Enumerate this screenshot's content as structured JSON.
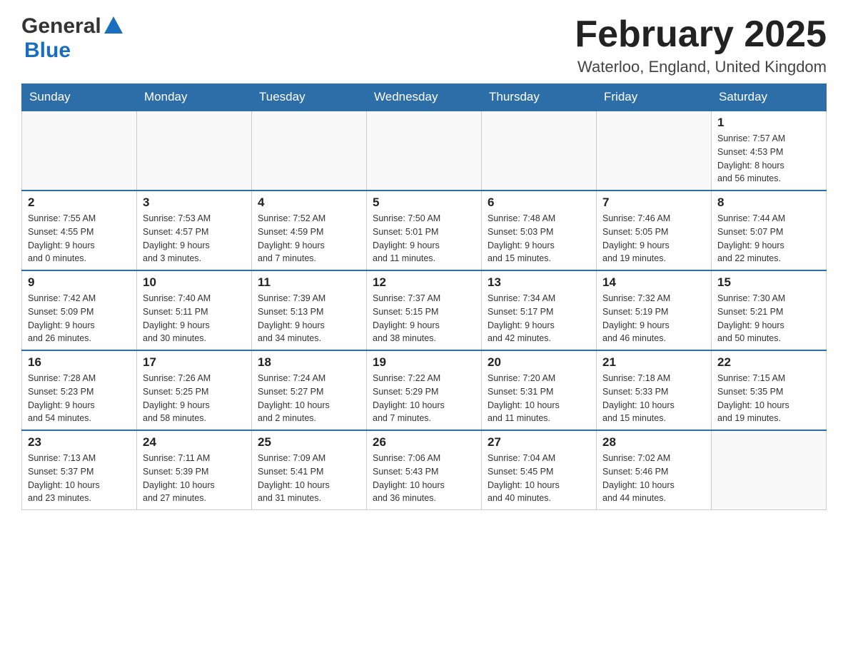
{
  "header": {
    "logo_general": "General",
    "logo_blue": "Blue",
    "month_title": "February 2025",
    "location": "Waterloo, England, United Kingdom"
  },
  "weekdays": [
    "Sunday",
    "Monday",
    "Tuesday",
    "Wednesday",
    "Thursday",
    "Friday",
    "Saturday"
  ],
  "weeks": [
    [
      {
        "day": "",
        "info": ""
      },
      {
        "day": "",
        "info": ""
      },
      {
        "day": "",
        "info": ""
      },
      {
        "day": "",
        "info": ""
      },
      {
        "day": "",
        "info": ""
      },
      {
        "day": "",
        "info": ""
      },
      {
        "day": "1",
        "info": "Sunrise: 7:57 AM\nSunset: 4:53 PM\nDaylight: 8 hours\nand 56 minutes."
      }
    ],
    [
      {
        "day": "2",
        "info": "Sunrise: 7:55 AM\nSunset: 4:55 PM\nDaylight: 9 hours\nand 0 minutes."
      },
      {
        "day": "3",
        "info": "Sunrise: 7:53 AM\nSunset: 4:57 PM\nDaylight: 9 hours\nand 3 minutes."
      },
      {
        "day": "4",
        "info": "Sunrise: 7:52 AM\nSunset: 4:59 PM\nDaylight: 9 hours\nand 7 minutes."
      },
      {
        "day": "5",
        "info": "Sunrise: 7:50 AM\nSunset: 5:01 PM\nDaylight: 9 hours\nand 11 minutes."
      },
      {
        "day": "6",
        "info": "Sunrise: 7:48 AM\nSunset: 5:03 PM\nDaylight: 9 hours\nand 15 minutes."
      },
      {
        "day": "7",
        "info": "Sunrise: 7:46 AM\nSunset: 5:05 PM\nDaylight: 9 hours\nand 19 minutes."
      },
      {
        "day": "8",
        "info": "Sunrise: 7:44 AM\nSunset: 5:07 PM\nDaylight: 9 hours\nand 22 minutes."
      }
    ],
    [
      {
        "day": "9",
        "info": "Sunrise: 7:42 AM\nSunset: 5:09 PM\nDaylight: 9 hours\nand 26 minutes."
      },
      {
        "day": "10",
        "info": "Sunrise: 7:40 AM\nSunset: 5:11 PM\nDaylight: 9 hours\nand 30 minutes."
      },
      {
        "day": "11",
        "info": "Sunrise: 7:39 AM\nSunset: 5:13 PM\nDaylight: 9 hours\nand 34 minutes."
      },
      {
        "day": "12",
        "info": "Sunrise: 7:37 AM\nSunset: 5:15 PM\nDaylight: 9 hours\nand 38 minutes."
      },
      {
        "day": "13",
        "info": "Sunrise: 7:34 AM\nSunset: 5:17 PM\nDaylight: 9 hours\nand 42 minutes."
      },
      {
        "day": "14",
        "info": "Sunrise: 7:32 AM\nSunset: 5:19 PM\nDaylight: 9 hours\nand 46 minutes."
      },
      {
        "day": "15",
        "info": "Sunrise: 7:30 AM\nSunset: 5:21 PM\nDaylight: 9 hours\nand 50 minutes."
      }
    ],
    [
      {
        "day": "16",
        "info": "Sunrise: 7:28 AM\nSunset: 5:23 PM\nDaylight: 9 hours\nand 54 minutes."
      },
      {
        "day": "17",
        "info": "Sunrise: 7:26 AM\nSunset: 5:25 PM\nDaylight: 9 hours\nand 58 minutes."
      },
      {
        "day": "18",
        "info": "Sunrise: 7:24 AM\nSunset: 5:27 PM\nDaylight: 10 hours\nand 2 minutes."
      },
      {
        "day": "19",
        "info": "Sunrise: 7:22 AM\nSunset: 5:29 PM\nDaylight: 10 hours\nand 7 minutes."
      },
      {
        "day": "20",
        "info": "Sunrise: 7:20 AM\nSunset: 5:31 PM\nDaylight: 10 hours\nand 11 minutes."
      },
      {
        "day": "21",
        "info": "Sunrise: 7:18 AM\nSunset: 5:33 PM\nDaylight: 10 hours\nand 15 minutes."
      },
      {
        "day": "22",
        "info": "Sunrise: 7:15 AM\nSunset: 5:35 PM\nDaylight: 10 hours\nand 19 minutes."
      }
    ],
    [
      {
        "day": "23",
        "info": "Sunrise: 7:13 AM\nSunset: 5:37 PM\nDaylight: 10 hours\nand 23 minutes."
      },
      {
        "day": "24",
        "info": "Sunrise: 7:11 AM\nSunset: 5:39 PM\nDaylight: 10 hours\nand 27 minutes."
      },
      {
        "day": "25",
        "info": "Sunrise: 7:09 AM\nSunset: 5:41 PM\nDaylight: 10 hours\nand 31 minutes."
      },
      {
        "day": "26",
        "info": "Sunrise: 7:06 AM\nSunset: 5:43 PM\nDaylight: 10 hours\nand 36 minutes."
      },
      {
        "day": "27",
        "info": "Sunrise: 7:04 AM\nSunset: 5:45 PM\nDaylight: 10 hours\nand 40 minutes."
      },
      {
        "day": "28",
        "info": "Sunrise: 7:02 AM\nSunset: 5:46 PM\nDaylight: 10 hours\nand 44 minutes."
      },
      {
        "day": "",
        "info": ""
      }
    ]
  ]
}
